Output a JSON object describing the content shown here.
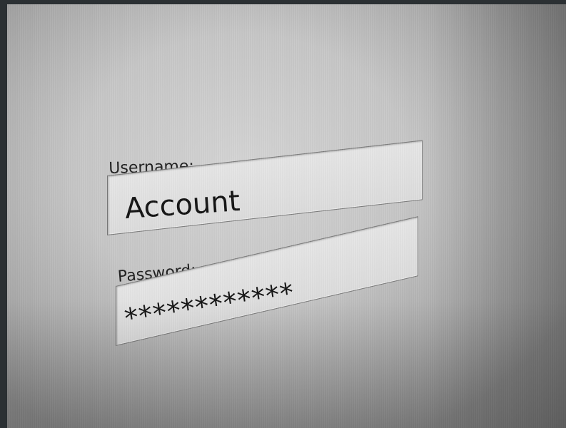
{
  "login_form": {
    "username": {
      "label": "Username:",
      "value": "Account"
    },
    "password": {
      "label": "Password:",
      "value": "************"
    }
  },
  "colors": {
    "bezel": "#2b3033",
    "screen": "#c8c8c8",
    "field_background": "#e0e0e0",
    "text": "#111111"
  }
}
